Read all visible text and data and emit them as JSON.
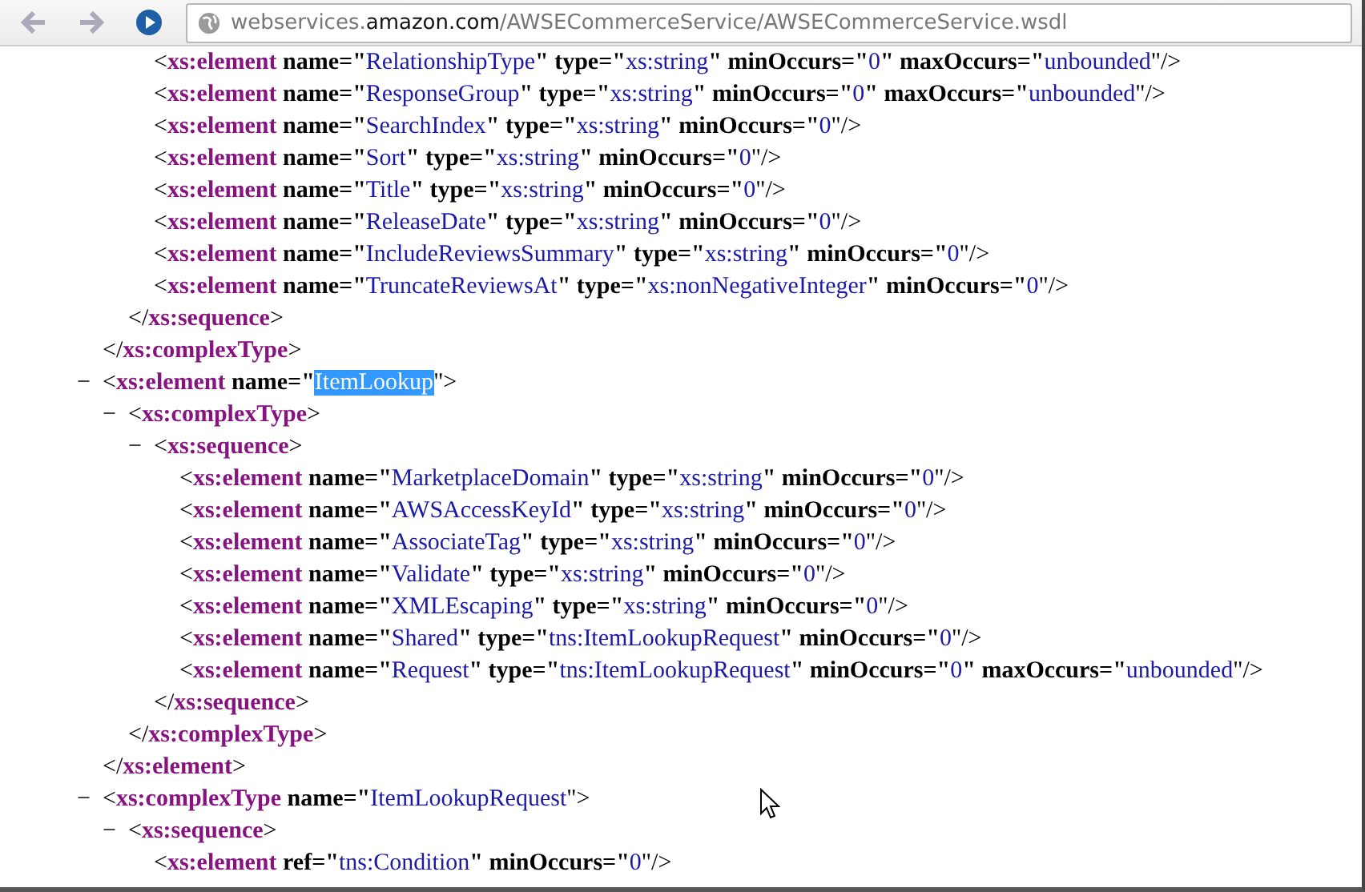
{
  "toolbar": {
    "url": {
      "subdomain": "webservices.",
      "domain": "amazon.com",
      "path": "/AWSECommerceService/AWSECommerceService.wsdl"
    }
  },
  "xml": [
    {
      "close": [
        {
          "kind": "p",
          "text": "</"
        },
        {
          "kind": "t",
          "text": "xs:complexType"
        },
        {
          "kind": "p",
          "text": ">"
        }
      ],
      "children": [
        {
          "close": [
            {
              "kind": "p",
              "text": "</"
            },
            {
              "kind": "t",
              "text": "xs:sequence"
            },
            {
              "kind": "p",
              "text": ">"
            }
          ],
          "children": [
            {
              "open": [
                {
                  "kind": "p",
                  "text": "<"
                },
                {
                  "kind": "t",
                  "text": "xs:element"
                },
                {
                  "kind": "a",
                  "text": " name=\""
                },
                {
                  "kind": "v",
                  "text": "RelationshipType",
                  "selected": false
                },
                {
                  "kind": "a",
                  "text": "\" type=\""
                },
                {
                  "kind": "v",
                  "text": "xs:string",
                  "selected": false
                },
                {
                  "kind": "a",
                  "text": "\" minOccurs=\""
                },
                {
                  "kind": "v",
                  "text": "0",
                  "selected": false
                },
                {
                  "kind": "a",
                  "text": "\" maxOccurs=\""
                },
                {
                  "kind": "v",
                  "text": "unbounded",
                  "selected": false
                },
                {
                  "kind": "p",
                  "text": "\"/>"
                }
              ]
            },
            {
              "open": [
                {
                  "kind": "p",
                  "text": "<"
                },
                {
                  "kind": "t",
                  "text": "xs:element"
                },
                {
                  "kind": "a",
                  "text": " name=\""
                },
                {
                  "kind": "v",
                  "text": "ResponseGroup",
                  "selected": false
                },
                {
                  "kind": "a",
                  "text": "\" type=\""
                },
                {
                  "kind": "v",
                  "text": "xs:string",
                  "selected": false
                },
                {
                  "kind": "a",
                  "text": "\" minOccurs=\""
                },
                {
                  "kind": "v",
                  "text": "0",
                  "selected": false
                },
                {
                  "kind": "a",
                  "text": "\" maxOccurs=\""
                },
                {
                  "kind": "v",
                  "text": "unbounded",
                  "selected": false
                },
                {
                  "kind": "p",
                  "text": "\"/>"
                }
              ]
            },
            {
              "open": [
                {
                  "kind": "p",
                  "text": "<"
                },
                {
                  "kind": "t",
                  "text": "xs:element"
                },
                {
                  "kind": "a",
                  "text": " name=\""
                },
                {
                  "kind": "v",
                  "text": "SearchIndex",
                  "selected": false
                },
                {
                  "kind": "a",
                  "text": "\" type=\""
                },
                {
                  "kind": "v",
                  "text": "xs:string",
                  "selected": false
                },
                {
                  "kind": "a",
                  "text": "\" minOccurs=\""
                },
                {
                  "kind": "v",
                  "text": "0",
                  "selected": false
                },
                {
                  "kind": "p",
                  "text": "\"/>"
                }
              ]
            },
            {
              "open": [
                {
                  "kind": "p",
                  "text": "<"
                },
                {
                  "kind": "t",
                  "text": "xs:element"
                },
                {
                  "kind": "a",
                  "text": " name=\""
                },
                {
                  "kind": "v",
                  "text": "Sort",
                  "selected": false
                },
                {
                  "kind": "a",
                  "text": "\" type=\""
                },
                {
                  "kind": "v",
                  "text": "xs:string",
                  "selected": false
                },
                {
                  "kind": "a",
                  "text": "\" minOccurs=\""
                },
                {
                  "kind": "v",
                  "text": "0",
                  "selected": false
                },
                {
                  "kind": "p",
                  "text": "\"/>"
                }
              ]
            },
            {
              "open": [
                {
                  "kind": "p",
                  "text": "<"
                },
                {
                  "kind": "t",
                  "text": "xs:element"
                },
                {
                  "kind": "a",
                  "text": " name=\""
                },
                {
                  "kind": "v",
                  "text": "Title",
                  "selected": false
                },
                {
                  "kind": "a",
                  "text": "\" type=\""
                },
                {
                  "kind": "v",
                  "text": "xs:string",
                  "selected": false
                },
                {
                  "kind": "a",
                  "text": "\" minOccurs=\""
                },
                {
                  "kind": "v",
                  "text": "0",
                  "selected": false
                },
                {
                  "kind": "p",
                  "text": "\"/>"
                }
              ]
            },
            {
              "open": [
                {
                  "kind": "p",
                  "text": "<"
                },
                {
                  "kind": "t",
                  "text": "xs:element"
                },
                {
                  "kind": "a",
                  "text": " name=\""
                },
                {
                  "kind": "v",
                  "text": "ReleaseDate",
                  "selected": false
                },
                {
                  "kind": "a",
                  "text": "\" type=\""
                },
                {
                  "kind": "v",
                  "text": "xs:string",
                  "selected": false
                },
                {
                  "kind": "a",
                  "text": "\" minOccurs=\""
                },
                {
                  "kind": "v",
                  "text": "0",
                  "selected": false
                },
                {
                  "kind": "p",
                  "text": "\"/>"
                }
              ]
            },
            {
              "open": [
                {
                  "kind": "p",
                  "text": "<"
                },
                {
                  "kind": "t",
                  "text": "xs:element"
                },
                {
                  "kind": "a",
                  "text": " name=\""
                },
                {
                  "kind": "v",
                  "text": "IncludeReviewsSummary",
                  "selected": false
                },
                {
                  "kind": "a",
                  "text": "\" type=\""
                },
                {
                  "kind": "v",
                  "text": "xs:string",
                  "selected": false
                },
                {
                  "kind": "a",
                  "text": "\" minOccurs=\""
                },
                {
                  "kind": "v",
                  "text": "0",
                  "selected": false
                },
                {
                  "kind": "p",
                  "text": "\"/>"
                }
              ]
            },
            {
              "open": [
                {
                  "kind": "p",
                  "text": "<"
                },
                {
                  "kind": "t",
                  "text": "xs:element"
                },
                {
                  "kind": "a",
                  "text": " name=\""
                },
                {
                  "kind": "v",
                  "text": "TruncateReviewsAt",
                  "selected": false
                },
                {
                  "kind": "a",
                  "text": "\" type=\""
                },
                {
                  "kind": "v",
                  "text": "xs:nonNegativeInteger",
                  "selected": false
                },
                {
                  "kind": "a",
                  "text": "\" minOccurs=\""
                },
                {
                  "kind": "v",
                  "text": "0",
                  "selected": false
                },
                {
                  "kind": "p",
                  "text": "\"/>"
                }
              ]
            }
          ]
        }
      ]
    },
    {
      "toggle": "−",
      "open": [
        {
          "kind": "p",
          "text": "<"
        },
        {
          "kind": "t",
          "text": "xs:element"
        },
        {
          "kind": "a",
          "text": " name=\""
        },
        {
          "kind": "v",
          "text": "ItemLookup",
          "selected": true
        },
        {
          "kind": "p",
          "text": "\">"
        }
      ],
      "close": [
        {
          "kind": "p",
          "text": "</"
        },
        {
          "kind": "t",
          "text": "xs:element"
        },
        {
          "kind": "p",
          "text": ">"
        }
      ],
      "children": [
        {
          "toggle": "−",
          "open": [
            {
              "kind": "p",
              "text": "<"
            },
            {
              "kind": "t",
              "text": "xs:complexType"
            },
            {
              "kind": "p",
              "text": ">"
            }
          ],
          "close": [
            {
              "kind": "p",
              "text": "</"
            },
            {
              "kind": "t",
              "text": "xs:complexType"
            },
            {
              "kind": "p",
              "text": ">"
            }
          ],
          "children": [
            {
              "toggle": "−",
              "open": [
                {
                  "kind": "p",
                  "text": "<"
                },
                {
                  "kind": "t",
                  "text": "xs:sequence"
                },
                {
                  "kind": "p",
                  "text": ">"
                }
              ],
              "close": [
                {
                  "kind": "p",
                  "text": "</"
                },
                {
                  "kind": "t",
                  "text": "xs:sequence"
                },
                {
                  "kind": "p",
                  "text": ">"
                }
              ],
              "children": [
                {
                  "open": [
                    {
                      "kind": "p",
                      "text": "<"
                    },
                    {
                      "kind": "t",
                      "text": "xs:element"
                    },
                    {
                      "kind": "a",
                      "text": " name=\""
                    },
                    {
                      "kind": "v",
                      "text": "MarketplaceDomain",
                      "selected": false
                    },
                    {
                      "kind": "a",
                      "text": "\" type=\""
                    },
                    {
                      "kind": "v",
                      "text": "xs:string",
                      "selected": false
                    },
                    {
                      "kind": "a",
                      "text": "\" minOccurs=\""
                    },
                    {
                      "kind": "v",
                      "text": "0",
                      "selected": false
                    },
                    {
                      "kind": "p",
                      "text": "\"/>"
                    }
                  ]
                },
                {
                  "open": [
                    {
                      "kind": "p",
                      "text": "<"
                    },
                    {
                      "kind": "t",
                      "text": "xs:element"
                    },
                    {
                      "kind": "a",
                      "text": " name=\""
                    },
                    {
                      "kind": "v",
                      "text": "AWSAccessKeyId",
                      "selected": false
                    },
                    {
                      "kind": "a",
                      "text": "\" type=\""
                    },
                    {
                      "kind": "v",
                      "text": "xs:string",
                      "selected": false
                    },
                    {
                      "kind": "a",
                      "text": "\" minOccurs=\""
                    },
                    {
                      "kind": "v",
                      "text": "0",
                      "selected": false
                    },
                    {
                      "kind": "p",
                      "text": "\"/>"
                    }
                  ]
                },
                {
                  "open": [
                    {
                      "kind": "p",
                      "text": "<"
                    },
                    {
                      "kind": "t",
                      "text": "xs:element"
                    },
                    {
                      "kind": "a",
                      "text": " name=\""
                    },
                    {
                      "kind": "v",
                      "text": "AssociateTag",
                      "selected": false
                    },
                    {
                      "kind": "a",
                      "text": "\" type=\""
                    },
                    {
                      "kind": "v",
                      "text": "xs:string",
                      "selected": false
                    },
                    {
                      "kind": "a",
                      "text": "\" minOccurs=\""
                    },
                    {
                      "kind": "v",
                      "text": "0",
                      "selected": false
                    },
                    {
                      "kind": "p",
                      "text": "\"/>"
                    }
                  ]
                },
                {
                  "open": [
                    {
                      "kind": "p",
                      "text": "<"
                    },
                    {
                      "kind": "t",
                      "text": "xs:element"
                    },
                    {
                      "kind": "a",
                      "text": " name=\""
                    },
                    {
                      "kind": "v",
                      "text": "Validate",
                      "selected": false
                    },
                    {
                      "kind": "a",
                      "text": "\" type=\""
                    },
                    {
                      "kind": "v",
                      "text": "xs:string",
                      "selected": false
                    },
                    {
                      "kind": "a",
                      "text": "\" minOccurs=\""
                    },
                    {
                      "kind": "v",
                      "text": "0",
                      "selected": false
                    },
                    {
                      "kind": "p",
                      "text": "\"/>"
                    }
                  ]
                },
                {
                  "open": [
                    {
                      "kind": "p",
                      "text": "<"
                    },
                    {
                      "kind": "t",
                      "text": "xs:element"
                    },
                    {
                      "kind": "a",
                      "text": " name=\""
                    },
                    {
                      "kind": "v",
                      "text": "XMLEscaping",
                      "selected": false
                    },
                    {
                      "kind": "a",
                      "text": "\" type=\""
                    },
                    {
                      "kind": "v",
                      "text": "xs:string",
                      "selected": false
                    },
                    {
                      "kind": "a",
                      "text": "\" minOccurs=\""
                    },
                    {
                      "kind": "v",
                      "text": "0",
                      "selected": false
                    },
                    {
                      "kind": "p",
                      "text": "\"/>"
                    }
                  ]
                },
                {
                  "open": [
                    {
                      "kind": "p",
                      "text": "<"
                    },
                    {
                      "kind": "t",
                      "text": "xs:element"
                    },
                    {
                      "kind": "a",
                      "text": " name=\""
                    },
                    {
                      "kind": "v",
                      "text": "Shared",
                      "selected": false
                    },
                    {
                      "kind": "a",
                      "text": "\" type=\""
                    },
                    {
                      "kind": "v",
                      "text": "tns:ItemLookupRequest",
                      "selected": false
                    },
                    {
                      "kind": "a",
                      "text": "\" minOccurs=\""
                    },
                    {
                      "kind": "v",
                      "text": "0",
                      "selected": false
                    },
                    {
                      "kind": "p",
                      "text": "\"/>"
                    }
                  ]
                },
                {
                  "open": [
                    {
                      "kind": "p",
                      "text": "<"
                    },
                    {
                      "kind": "t",
                      "text": "xs:element"
                    },
                    {
                      "kind": "a",
                      "text": " name=\""
                    },
                    {
                      "kind": "v",
                      "text": "Request",
                      "selected": false
                    },
                    {
                      "kind": "a",
                      "text": "\" type=\""
                    },
                    {
                      "kind": "v",
                      "text": "tns:ItemLookupRequest",
                      "selected": false
                    },
                    {
                      "kind": "a",
                      "text": "\" minOccurs=\""
                    },
                    {
                      "kind": "v",
                      "text": "0",
                      "selected": false
                    },
                    {
                      "kind": "a",
                      "text": "\" maxOccurs=\""
                    },
                    {
                      "kind": "v",
                      "text": "unbounded",
                      "selected": false
                    },
                    {
                      "kind": "p",
                      "text": "\"/>"
                    }
                  ]
                }
              ]
            }
          ]
        }
      ]
    },
    {
      "toggle": "−",
      "open": [
        {
          "kind": "p",
          "text": "<"
        },
        {
          "kind": "t",
          "text": "xs:complexType"
        },
        {
          "kind": "a",
          "text": " name=\""
        },
        {
          "kind": "v",
          "text": "ItemLookupRequest",
          "selected": false
        },
        {
          "kind": "p",
          "text": "\">"
        }
      ],
      "children": [
        {
          "toggle": "−",
          "open": [
            {
              "kind": "p",
              "text": "<"
            },
            {
              "kind": "t",
              "text": "xs:sequence"
            },
            {
              "kind": "p",
              "text": ">"
            }
          ],
          "children": [
            {
              "open": [
                {
                  "kind": "p",
                  "text": "<"
                },
                {
                  "kind": "t",
                  "text": "xs:element"
                },
                {
                  "kind": "a",
                  "text": " ref=\""
                },
                {
                  "kind": "v",
                  "text": "tns:Condition",
                  "selected": false
                },
                {
                  "kind": "a",
                  "text": "\" minOccurs=\""
                },
                {
                  "kind": "v",
                  "text": "0",
                  "selected": false
                },
                {
                  "kind": "p",
                  "text": "\"/>"
                }
              ]
            }
          ]
        }
      ]
    }
  ]
}
